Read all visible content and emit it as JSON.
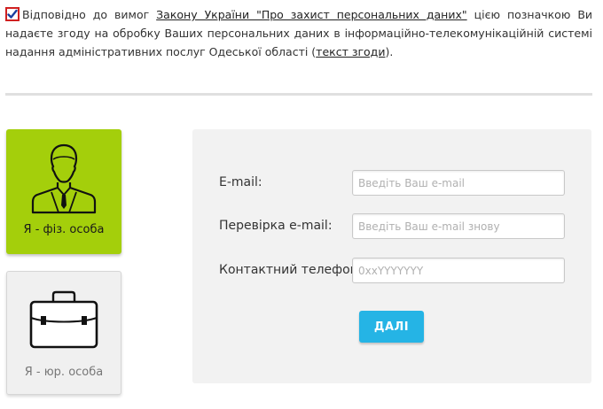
{
  "consent": {
    "checked": true,
    "text_before": "Відповідно до вимог ",
    "law_link": "Закону України \"Про захист персональних даних\"",
    "text_middle": " цією позначкою Ви надаєте згоду на обробку Ваших персональних даних в інформаційно-телекомунікаційній системі надання адміністративних послуг Одеської області (",
    "agreement_link": "текст згоди",
    "text_after": ")."
  },
  "person_types": [
    {
      "label": "Я - фіз. особа",
      "icon": "person-icon",
      "active": true
    },
    {
      "label": "Я - юр. особа",
      "icon": "briefcase-icon",
      "active": false
    }
  ],
  "form": {
    "email": {
      "label": "E-mail:",
      "value": "",
      "placeholder": "Введіть Ваш e-mail"
    },
    "email_check": {
      "label": "Перевірка e-mail:",
      "value": "",
      "placeholder": "Введіть Ваш e-mail знову"
    },
    "phone": {
      "label": "Контактний телефон:",
      "value": "",
      "placeholder": "0xxYYYYYYY"
    },
    "submit_label": "ДАЛІ"
  },
  "colors": {
    "active_tile": "#a4cf0b",
    "submit_button": "#25b4e5",
    "checkbox_border": "#d02020"
  }
}
